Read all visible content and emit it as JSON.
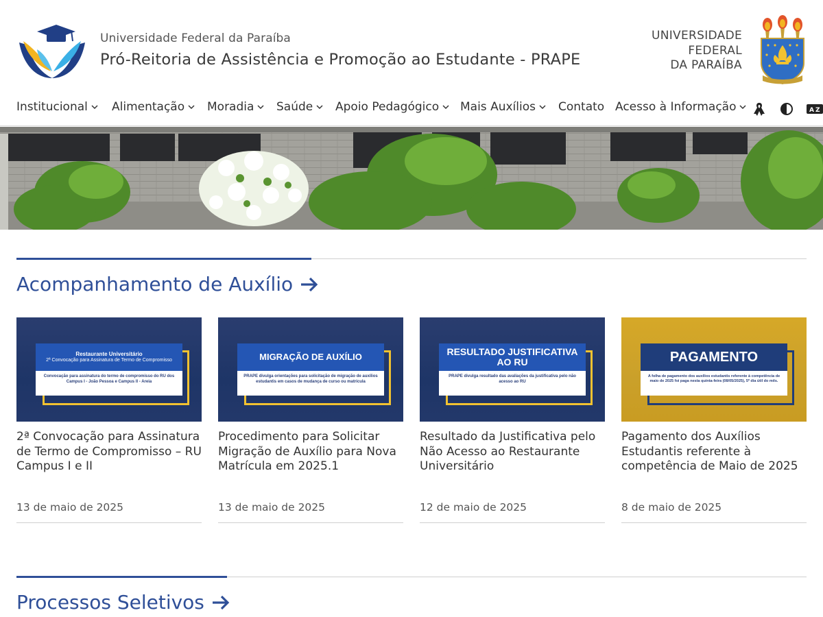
{
  "header": {
    "university": "Universidade Federal da Paraíba",
    "title": "Pró-Reitoria de Assistência e Promoção ao Estudante - PRAPE",
    "ufpb_line1": "UNIVERSIDADE",
    "ufpb_line2": "FEDERAL",
    "ufpb_line3": "DA PARAÍBA"
  },
  "nav": {
    "items": [
      {
        "label": "Institucional",
        "dropdown": true
      },
      {
        "label": "Alimentação",
        "dropdown": true
      },
      {
        "label": "Moradia",
        "dropdown": true
      },
      {
        "label": "Saúde",
        "dropdown": true
      },
      {
        "label": "Apoio Pedagógico",
        "dropdown": true
      },
      {
        "label": "Mais Auxílios",
        "dropdown": true
      },
      {
        "label": "Contato",
        "dropdown": false
      },
      {
        "label": "Acesso à Informação",
        "dropdown": true
      }
    ],
    "icons": [
      "ribbon-icon",
      "contrast-icon",
      "sign-language-icon"
    ]
  },
  "sections": {
    "acompanhamento": {
      "title": "Acompanhamento de Auxílio",
      "cards": [
        {
          "thumb_head": "Restaurante Universitário",
          "thumb_head2": "2ª Convocação para Assinatura de Termo de Compromisso",
          "thumb_body": "Convocação para assinatura do termo de compromisso do RU dos Campus I - João Pessoa e Campus II - Areia",
          "title": "2ª Convocação para Assinatura de Termo de Compromisso – RU Campus I e II",
          "date": "13 de maio de 2025"
        },
        {
          "thumb_head": "MIGRAÇÃO DE AUXÍLIO",
          "thumb_body": "PRAPE divulga orientações para solicitação de migração de auxílios estudantis em casos de mudança de curso ou matrícula",
          "title": "Procedimento para Solicitar Migração de Auxílio para Nova Matrícula em 2025.1",
          "date": "13 de maio de 2025"
        },
        {
          "thumb_head": "RESULTADO JUSTIFICATIVA AO RU",
          "thumb_body": "PRAPE divulga resultado das avaliações da justificativa pelo não acesso ao RU",
          "title": "Resultado da Justificativa pelo Não Acesso ao Restaurante Universitário",
          "date": "12 de maio de 2025"
        },
        {
          "thumb_head": "PAGAMENTO",
          "thumb_body": "A folha de pagamento dos auxílios estudantis referente à competência de maio de 2025 foi paga nesta quinta-feira (08/05/2025), 5º dia útil do mês.",
          "title": "Pagamento dos Auxílios Estudantis referente à competência de Maio de 2025",
          "date": "8 de maio de 2025"
        }
      ]
    },
    "processos": {
      "title": "Processos Seletivos"
    }
  },
  "colors": {
    "brand_blue": "#2f4f98",
    "accent_yellow": "#f2c230",
    "card_navy": "#1f3d7a",
    "card_gold": "#d9a520"
  }
}
